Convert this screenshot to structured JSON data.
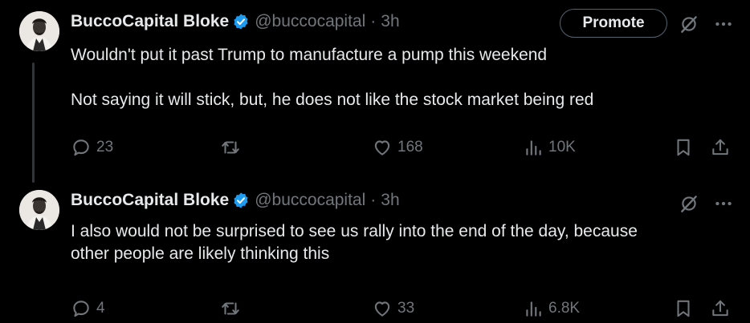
{
  "tweets": [
    {
      "name": "BuccoCapital Bloke",
      "handle": "@buccocapital",
      "separator": "·",
      "time": "3h",
      "promote_label": "Promote",
      "text": "Wouldn't put it past Trump to manufacture a pump this weekend\n\nNot saying it will stick, but, he does not like the stock market being red",
      "replies": "23",
      "likes": "168",
      "views": "10K"
    },
    {
      "name": "BuccoCapital Bloke",
      "handle": "@buccocapital",
      "separator": "·",
      "time": "3h",
      "text": "I also would not be surprised to see us rally into the end of the day, because\nother people are likely thinking this",
      "replies": "4",
      "likes": "33",
      "views": "6.8K"
    }
  ],
  "colors": {
    "background": "#000000",
    "primary_text": "#e7e9ea",
    "secondary_text": "#71767b",
    "verified_badge": "#1d9bf0"
  },
  "icons": [
    "verified-badge-icon",
    "grok-icon",
    "more-icon",
    "reply-icon",
    "retweet-icon",
    "like-icon",
    "views-icon",
    "bookmark-icon",
    "share-icon"
  ]
}
